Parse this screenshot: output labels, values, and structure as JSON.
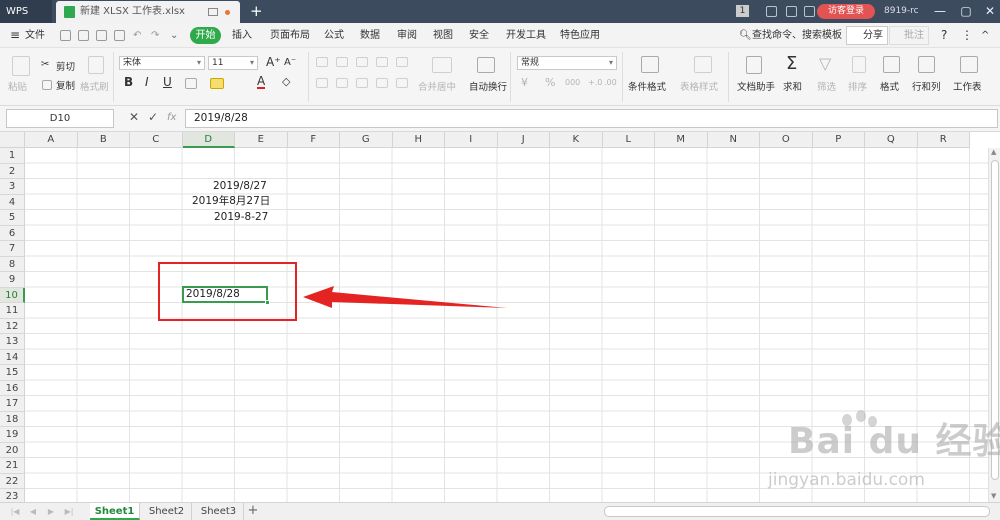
{
  "titlebar": {
    "app": "WPS",
    "tab_title": "新建 XLSX 工作表.xlsx",
    "new_tab": "+",
    "badge": "1",
    "login": "访客登录",
    "user": "8919-rc",
    "minimize": "—",
    "maximize": "▢",
    "close": "✕"
  },
  "menubar": {
    "file": "文件",
    "active_tab": "开始",
    "tabs": [
      "插入",
      "页面布局",
      "公式",
      "数据",
      "审阅",
      "视图",
      "安全",
      "开发工具",
      "特色应用"
    ],
    "search": "查找命令、搜索模板",
    "share": "分享",
    "comment": "批注",
    "help": "?",
    "more": "⋮",
    "collapse": "^"
  },
  "ribbon": {
    "paste": "粘贴",
    "cut": "剪切",
    "copy": "复制",
    "format_painter": "格式刷",
    "font_name": "宋体",
    "font_size": "11",
    "bold": "B",
    "italic": "I",
    "underline": "U",
    "font_color": "A",
    "grow_font": "A⁺",
    "shrink_font": "A⁻",
    "merge_center": "合并居中",
    "wrap_text": "自动换行",
    "number_format": "常规",
    "currency": "¥",
    "percent": "%",
    "thousands": "000",
    "cond_format": "条件格式",
    "table_style": "表格样式",
    "doc_assistant": "文档助手",
    "sum": "求和",
    "filter": "筛选",
    "sort": "排序",
    "format": "格式",
    "row_col": "行和列",
    "worksheet": "工作表"
  },
  "formula_bar": {
    "name_box": "D10",
    "cancel": "✕",
    "confirm": "✓",
    "fx": "fx",
    "value": "2019/8/28"
  },
  "grid": {
    "columns": [
      "A",
      "B",
      "C",
      "D",
      "E",
      "F",
      "G",
      "H",
      "I",
      "J",
      "K",
      "L",
      "M",
      "N",
      "O",
      "P",
      "Q",
      "R"
    ],
    "rows": [
      "1",
      "2",
      "3",
      "4",
      "5",
      "6",
      "7",
      "8",
      "9",
      "10",
      "11",
      "12",
      "13",
      "14",
      "15",
      "16",
      "17",
      "18",
      "19",
      "20",
      "21",
      "22",
      "23"
    ],
    "selected_column": "D",
    "selected_row": "10",
    "cells": {
      "D3": "2019/8/27",
      "D4": "2019年8月27日",
      "D5": "2019-8-27",
      "D10": "2019/8/28"
    }
  },
  "sheets": {
    "tabs": [
      "Sheet1",
      "Sheet2",
      "Sheet3"
    ],
    "active": "Sheet1",
    "add": "+"
  },
  "watermark": {
    "brand": "Bai du 经验",
    "url": "jingyan.baidu.com"
  },
  "colors": {
    "accent_green": "#2faa4b",
    "annotation_red": "#e42323",
    "titlebar": "#3c4b5e"
  }
}
